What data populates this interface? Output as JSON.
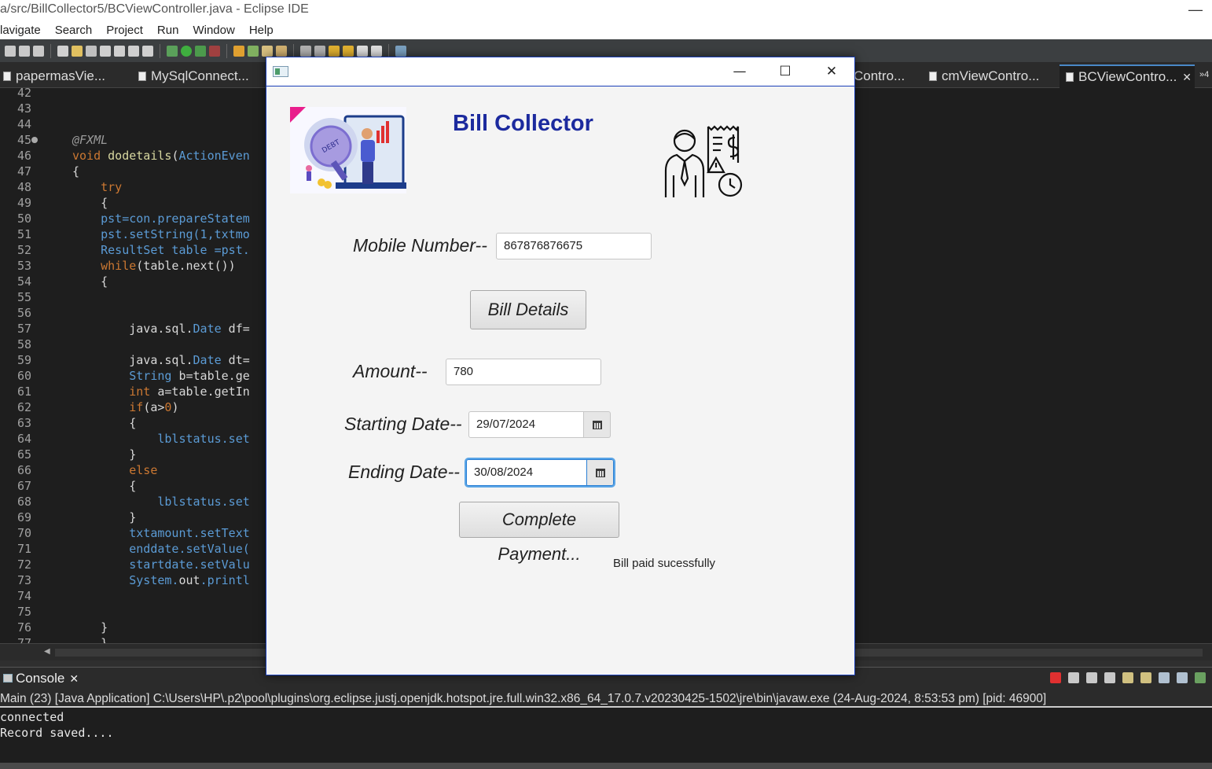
{
  "window": {
    "title": "a/src/BillCollector5/BCViewController.java - Eclipse IDE",
    "minimize_glyph": "—"
  },
  "menu": [
    "lavigate",
    "Search",
    "Project",
    "Run",
    "Window",
    "Help"
  ],
  "editor_tabs": [
    {
      "label": "papermasVie..."
    },
    {
      "label": "MySqlConnect..."
    },
    {
      "label": "Contro..."
    },
    {
      "label": "cmViewContro..."
    },
    {
      "label": "BCViewContro...",
      "active": true
    }
  ],
  "tab_overflow": "»4",
  "code_lines": [
    {
      "n": "42",
      "segs": []
    },
    {
      "n": "43",
      "segs": []
    },
    {
      "n": "44",
      "segs": []
    },
    {
      "n": "45",
      "segs": [
        {
          "t": "@FXML",
          "c": "ann"
        }
      ]
    },
    {
      "n": "46",
      "segs": [
        {
          "t": "void ",
          "c": "kw"
        },
        {
          "t": "dodetails",
          "c": "fn"
        },
        {
          "t": "("
        },
        {
          "t": "ActionEven",
          "c": "typ"
        }
      ]
    },
    {
      "n": "47",
      "segs": [
        {
          "t": "{"
        }
      ]
    },
    {
      "n": "48",
      "segs": [
        {
          "t": "    "
        },
        {
          "t": "try",
          "c": "kw"
        }
      ]
    },
    {
      "n": "49",
      "segs": [
        {
          "t": "    {"
        }
      ]
    },
    {
      "n": "50",
      "segs": [
        {
          "t": "    pst=con.prepareStatem",
          "c": "typ"
        }
      ]
    },
    {
      "n": "51",
      "segs": [
        {
          "t": "    pst.setString(1,txtmo",
          "c": "typ"
        }
      ]
    },
    {
      "n": "52",
      "segs": [
        {
          "t": "    ResultSet table =pst.",
          "c": "typ"
        }
      ]
    },
    {
      "n": "53",
      "segs": [
        {
          "t": "    "
        },
        {
          "t": "while",
          "c": "kw"
        },
        {
          "t": "(table.next())"
        }
      ]
    },
    {
      "n": "54",
      "segs": [
        {
          "t": "    {"
        }
      ]
    },
    {
      "n": "55",
      "segs": []
    },
    {
      "n": "56",
      "segs": []
    },
    {
      "n": "57",
      "segs": [
        {
          "t": "        java.sql."
        },
        {
          "t": "Date",
          "c": "typ"
        },
        {
          "t": " df="
        }
      ]
    },
    {
      "n": "58",
      "segs": []
    },
    {
      "n": "59",
      "segs": [
        {
          "t": "        java.sql."
        },
        {
          "t": "Date",
          "c": "typ"
        },
        {
          "t": " dt="
        }
      ]
    },
    {
      "n": "60",
      "segs": [
        {
          "t": "        "
        },
        {
          "t": "String",
          "c": "typ"
        },
        {
          "t": " b=table.ge"
        }
      ]
    },
    {
      "n": "61",
      "segs": [
        {
          "t": "        "
        },
        {
          "t": "int",
          "c": "kw"
        },
        {
          "t": " a=table.getIn"
        }
      ]
    },
    {
      "n": "62",
      "segs": [
        {
          "t": "        "
        },
        {
          "t": "if",
          "c": "kw"
        },
        {
          "t": "(a>"
        },
        {
          "t": "0",
          "c": "kw"
        },
        {
          "t": ")"
        }
      ]
    },
    {
      "n": "63",
      "segs": [
        {
          "t": "        {"
        }
      ]
    },
    {
      "n": "64",
      "segs": [
        {
          "t": "            lblstatus.set",
          "c": "typ"
        }
      ]
    },
    {
      "n": "65",
      "segs": [
        {
          "t": "        }"
        }
      ]
    },
    {
      "n": "66",
      "segs": [
        {
          "t": "        "
        },
        {
          "t": "else",
          "c": "kw"
        }
      ]
    },
    {
      "n": "67",
      "segs": [
        {
          "t": "        {"
        }
      ]
    },
    {
      "n": "68",
      "segs": [
        {
          "t": "            lblstatus.set",
          "c": "typ"
        }
      ]
    },
    {
      "n": "69",
      "segs": [
        {
          "t": "        }"
        }
      ]
    },
    {
      "n": "70",
      "segs": [
        {
          "t": "        txtamount.setText",
          "c": "typ"
        }
      ]
    },
    {
      "n": "71",
      "segs": [
        {
          "t": "        enddate.setValue(",
          "c": "typ"
        }
      ]
    },
    {
      "n": "72",
      "segs": [
        {
          "t": "        startdate.setValu",
          "c": "typ"
        }
      ]
    },
    {
      "n": "73",
      "segs": [
        {
          "t": "        System.",
          "c": "typ"
        },
        {
          "t": "out"
        },
        {
          "t": ".printl",
          "c": "typ"
        }
      ]
    },
    {
      "n": "74",
      "segs": []
    },
    {
      "n": "75",
      "segs": []
    },
    {
      "n": "76",
      "segs": [
        {
          "t": "    }"
        }
      ]
    },
    {
      "n": "77",
      "segs": [
        {
          "t": "    }"
        }
      ]
    }
  ],
  "console": {
    "tab_label": "Console",
    "info": "Main (23) [Java Application] C:\\Users\\HP\\.p2\\pool\\plugins\\org.eclipse.justj.openjdk.hotspot.jre.full.win32.x86_64_17.0.7.v20230425-1502\\jre\\bin\\javaw.exe  (24-Aug-2024, 8:53:53 pm) [pid: 46900]",
    "output": [
      "connected",
      "Record saved...."
    ]
  },
  "dialog": {
    "title": "Bill Collector",
    "left_logo_text": "DEBT",
    "mobile_label": "Mobile Number--",
    "mobile_value": "867876876675",
    "bill_details_button": "Bill Details",
    "amount_label": "Amount--",
    "amount_value": "780",
    "start_label": "Starting Date--",
    "start_value": "29/07/2024",
    "end_label": "Ending Date--",
    "end_value": "30/08/2024",
    "pay_button": "Complete Payment...",
    "status": "Bill paid sucessfully",
    "win_minimize": "—",
    "win_maximize": "☐",
    "win_close": "✕"
  },
  "colors": {
    "title_blue": "#1c2a9e",
    "dialog_border": "#1a3fb8",
    "focus_blue": "#2a7fd4"
  }
}
